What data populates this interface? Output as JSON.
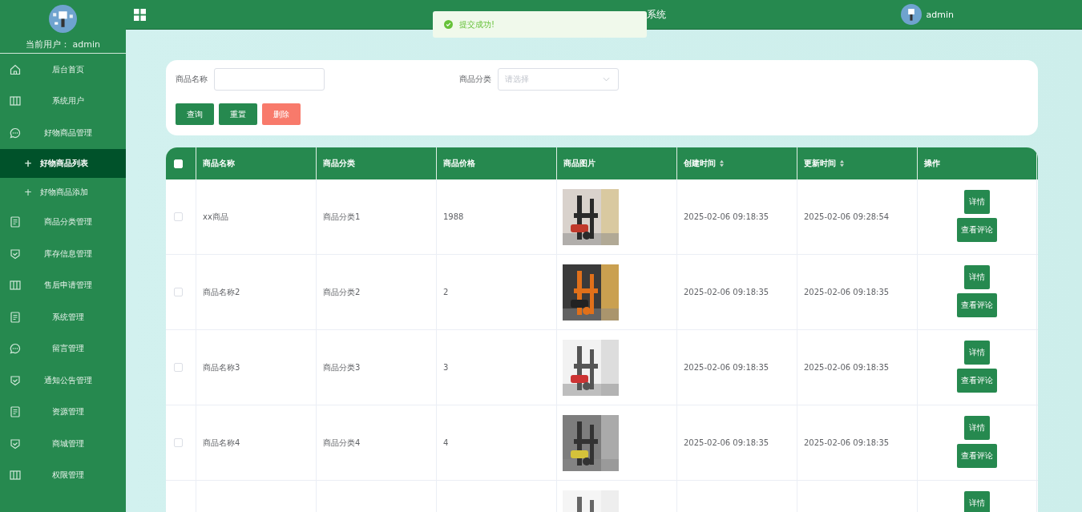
{
  "sidebar": {
    "user_label": "当前用户： admin",
    "items": [
      {
        "label": "后台首页",
        "kind": "home"
      },
      {
        "label": "系统用户",
        "kind": "columns"
      },
      {
        "label": "好物商品管理",
        "kind": "chat",
        "children": [
          {
            "bullet": "+",
            "label": "好物商品列表",
            "selected": true
          },
          {
            "bullet": "+",
            "label": "好物商品添加",
            "selected": false
          }
        ]
      },
      {
        "label": "商品分类管理",
        "kind": "doc"
      },
      {
        "label": "库存信息管理",
        "kind": "shield"
      },
      {
        "label": "售后申请管理",
        "kind": "columns"
      },
      {
        "label": "系统管理",
        "kind": "doc"
      },
      {
        "label": "留言管理",
        "kind": "chat"
      },
      {
        "label": "通知公告管理",
        "kind": "shield"
      },
      {
        "label": "资源管理",
        "kind": "doc"
      },
      {
        "label": "商城管理",
        "kind": "shield"
      },
      {
        "label": "权限管理",
        "kind": "columns"
      }
    ]
  },
  "header": {
    "title": "系统",
    "user": "admin"
  },
  "toast": {
    "message": "提交成功!"
  },
  "search": {
    "fields": [
      {
        "label": "商品名称",
        "kind": "input"
      },
      {
        "label": "商品分类",
        "kind": "select",
        "placeholder": "请选择"
      }
    ],
    "buttons": [
      {
        "label": "查询",
        "kind": "primary"
      },
      {
        "label": "重置",
        "kind": "primary"
      },
      {
        "label": "删除",
        "kind": "danger"
      }
    ]
  },
  "table": {
    "all_checked": false,
    "columns": [
      {
        "label": "商品名称",
        "sortable": false
      },
      {
        "label": "商品分类",
        "sortable": false
      },
      {
        "label": "商品价格",
        "sortable": false
      },
      {
        "label": "商品图片",
        "sortable": false
      },
      {
        "label": "创建时间",
        "sortable": true
      },
      {
        "label": "更新时间",
        "sortable": true
      },
      {
        "label": "操作",
        "sortable": false
      }
    ],
    "rows": [
      {
        "checked": false,
        "name": "xx商品",
        "category": "商品分类1",
        "price": "1988",
        "created": "2025-02-06 09:18:35",
        "updated": "2025-02-06 09:28:54",
        "actions": [
          "详情",
          "查看评论"
        ]
      },
      {
        "checked": false,
        "name": "商品名称2",
        "category": "商品分类2",
        "price": "2",
        "created": "2025-02-06 09:18:35",
        "updated": "2025-02-06 09:18:35",
        "actions": [
          "详情",
          "查看评论"
        ]
      },
      {
        "checked": false,
        "name": "商品名称3",
        "category": "商品分类3",
        "price": "3",
        "created": "2025-02-06 09:18:35",
        "updated": "2025-02-06 09:18:35",
        "actions": [
          "详情",
          "查看评论"
        ]
      },
      {
        "checked": false,
        "name": "商品名称4",
        "category": "商品分类4",
        "price": "4",
        "created": "2025-02-06 09:18:35",
        "updated": "2025-02-06 09:18:35",
        "actions": [
          "详情",
          "查看评论"
        ]
      },
      {
        "actions": [
          "详情"
        ]
      }
    ]
  }
}
